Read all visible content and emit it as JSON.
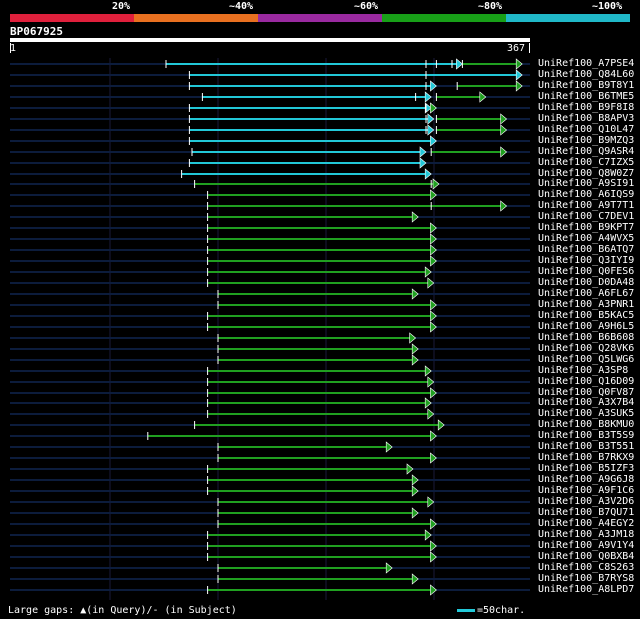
{
  "scale": {
    "labels": [
      "20%",
      "~40%",
      "~60%",
      "~80%",
      "~100%"
    ],
    "colors": [
      "#e0203c",
      "#e87020",
      "#9a2aa0",
      "#18a018",
      "#20b8c8"
    ]
  },
  "query": {
    "name": "BP067925",
    "start": "1",
    "end": "367"
  },
  "footer": {
    "gaps_text": "Large gaps: ▲(in Query)/- (in Subject)",
    "scale_text": "=50char."
  },
  "hits": [
    {
      "label": "UniRef100_A7PSE4",
      "segments": [
        {
          "color": "#22c8d8",
          "range": [
            0.3,
            0.87
          ]
        },
        {
          "color": "#20a020",
          "range": [
            0.87,
            0.985
          ]
        }
      ],
      "ticks": [
        0.8,
        0.82,
        0.85
      ]
    },
    {
      "label": "UniRef100_Q84L60",
      "segments": [
        {
          "color": "#22c8d8",
          "range": [
            0.345,
            0.985
          ]
        }
      ],
      "ticks": [
        0.8
      ]
    },
    {
      "label": "UniRef100_B9T8Y1",
      "segments": [
        {
          "color": "#22c8d8",
          "range": [
            0.345,
            0.82
          ]
        },
        {
          "color": "#20a020",
          "range": [
            0.86,
            0.985
          ]
        }
      ],
      "ticks": [
        0.8
      ]
    },
    {
      "label": "UniRef100_B6TME5",
      "segments": [
        {
          "color": "#22c8d8",
          "range": [
            0.37,
            0.81
          ]
        },
        {
          "color": "#20a020",
          "range": [
            0.82,
            0.915
          ]
        }
      ],
      "ticks": [
        0.78
      ]
    },
    {
      "label": "UniRef100_B9F8I8",
      "segments": [
        {
          "color": "#22c8d8",
          "range": [
            0.345,
            0.81
          ]
        },
        {
          "color": "#20a020",
          "range": [
            0.81,
            0.82
          ]
        }
      ],
      "ticks": [
        0.8
      ]
    },
    {
      "label": "UniRef100_B8APV3",
      "segments": [
        {
          "color": "#22c8d8",
          "range": [
            0.345,
            0.815
          ]
        },
        {
          "color": "#20a020",
          "range": [
            0.82,
            0.955
          ]
        }
      ],
      "ticks": [
        0.8
      ]
    },
    {
      "label": "UniRef100_Q10L47",
      "segments": [
        {
          "color": "#22c8d8",
          "range": [
            0.345,
            0.815
          ]
        },
        {
          "color": "#20a020",
          "range": [
            0.82,
            0.955
          ]
        }
      ],
      "ticks": [
        0.8
      ]
    },
    {
      "label": "UniRef100_B9MZQ3",
      "segments": [
        {
          "color": "#22c8d8",
          "range": [
            0.345,
            0.82
          ]
        }
      ],
      "ticks": []
    },
    {
      "label": "UniRef100_Q9ASR4",
      "segments": [
        {
          "color": "#22c8d8",
          "range": [
            0.35,
            0.8
          ]
        },
        {
          "color": "#20a020",
          "range": [
            0.81,
            0.955
          ]
        }
      ],
      "ticks": []
    },
    {
      "label": "UniRef100_C7IZX5",
      "segments": [
        {
          "color": "#22c8d8",
          "range": [
            0.345,
            0.8
          ]
        }
      ],
      "ticks": []
    },
    {
      "label": "UniRef100_Q8W0Z7",
      "segments": [
        {
          "color": "#22c8d8",
          "range": [
            0.33,
            0.81
          ]
        }
      ],
      "ticks": []
    },
    {
      "label": "UniRef100_A9SI91",
      "segments": [
        {
          "color": "#20a020",
          "range": [
            0.355,
            0.825
          ]
        }
      ],
      "ticks": [
        0.81
      ]
    },
    {
      "label": "UniRef100_A6IQS9",
      "segments": [
        {
          "color": "#20a020",
          "range": [
            0.38,
            0.82
          ]
        }
      ],
      "ticks": []
    },
    {
      "label": "UniRef100_A9T7T1",
      "segments": [
        {
          "color": "#20a020",
          "range": [
            0.38,
            0.955
          ]
        }
      ],
      "ticks": [
        0.81
      ]
    },
    {
      "label": "UniRef100_C7DEV1",
      "segments": [
        {
          "color": "#20a020",
          "range": [
            0.38,
            0.785
          ]
        }
      ],
      "ticks": []
    },
    {
      "label": "UniRef100_B9KPT7",
      "segments": [
        {
          "color": "#20a020",
          "range": [
            0.38,
            0.82
          ]
        }
      ],
      "ticks": []
    },
    {
      "label": "UniRef100_A4WVX5",
      "segments": [
        {
          "color": "#20a020",
          "range": [
            0.38,
            0.82
          ]
        }
      ],
      "ticks": []
    },
    {
      "label": "UniRef100_B6ATQ7",
      "segments": [
        {
          "color": "#20a020",
          "range": [
            0.38,
            0.82
          ]
        }
      ],
      "ticks": []
    },
    {
      "label": "UniRef100_Q3IYI9",
      "segments": [
        {
          "color": "#20a020",
          "range": [
            0.38,
            0.82
          ]
        }
      ],
      "ticks": []
    },
    {
      "label": "UniRef100_Q0FES6",
      "segments": [
        {
          "color": "#20a020",
          "range": [
            0.38,
            0.81
          ]
        }
      ],
      "ticks": []
    },
    {
      "label": "UniRef100_D0DA48",
      "segments": [
        {
          "color": "#20a020",
          "range": [
            0.38,
            0.815
          ]
        }
      ],
      "ticks": []
    },
    {
      "label": "UniRef100_A6FL67",
      "segments": [
        {
          "color": "#20a020",
          "range": [
            0.4,
            0.785
          ]
        }
      ],
      "ticks": []
    },
    {
      "label": "UniRef100_A3PNR1",
      "segments": [
        {
          "color": "#20a020",
          "range": [
            0.4,
            0.82
          ]
        }
      ],
      "ticks": []
    },
    {
      "label": "UniRef100_B5KAC5",
      "segments": [
        {
          "color": "#20a020",
          "range": [
            0.38,
            0.82
          ]
        }
      ],
      "ticks": []
    },
    {
      "label": "UniRef100_A9H6L5",
      "segments": [
        {
          "color": "#20a020",
          "range": [
            0.38,
            0.82
          ]
        }
      ],
      "ticks": []
    },
    {
      "label": "UniRef100_B6B608",
      "segments": [
        {
          "color": "#20a020",
          "range": [
            0.4,
            0.78
          ]
        }
      ],
      "ticks": []
    },
    {
      "label": "UniRef100_Q28VK6",
      "segments": [
        {
          "color": "#20a020",
          "range": [
            0.4,
            0.785
          ]
        }
      ],
      "ticks": []
    },
    {
      "label": "UniRef100_Q5LWG6",
      "segments": [
        {
          "color": "#20a020",
          "range": [
            0.4,
            0.785
          ]
        }
      ],
      "ticks": []
    },
    {
      "label": "UniRef100_A3SP8",
      "segments": [
        {
          "color": "#20a020",
          "range": [
            0.38,
            0.81
          ]
        }
      ],
      "ticks": []
    },
    {
      "label": "UniRef100_Q16D09",
      "segments": [
        {
          "color": "#20a020",
          "range": [
            0.38,
            0.815
          ]
        }
      ],
      "ticks": []
    },
    {
      "label": "UniRef100_Q0FV87",
      "segments": [
        {
          "color": "#20a020",
          "range": [
            0.38,
            0.82
          ]
        }
      ],
      "ticks": []
    },
    {
      "label": "UniRef100_A3X7B4",
      "segments": [
        {
          "color": "#20a020",
          "range": [
            0.38,
            0.81
          ]
        }
      ],
      "ticks": []
    },
    {
      "label": "UniRef100_A3SUK5",
      "segments": [
        {
          "color": "#20a020",
          "range": [
            0.38,
            0.815
          ]
        }
      ],
      "ticks": []
    },
    {
      "label": "UniRef100_B8KMU0",
      "segments": [
        {
          "color": "#20a020",
          "range": [
            0.355,
            0.835
          ]
        }
      ],
      "ticks": []
    },
    {
      "label": "UniRef100_B3T5S9",
      "segments": [
        {
          "color": "#20a020",
          "range": [
            0.265,
            0.82
          ]
        }
      ],
      "ticks": []
    },
    {
      "label": "UniRef100_B3T551",
      "segments": [
        {
          "color": "#20a020",
          "range": [
            0.4,
            0.735
          ]
        }
      ],
      "ticks": []
    },
    {
      "label": "UniRef100_B7RKX9",
      "segments": [
        {
          "color": "#20a020",
          "range": [
            0.4,
            0.82
          ]
        }
      ],
      "ticks": []
    },
    {
      "label": "UniRef100_B5IZF3",
      "segments": [
        {
          "color": "#20a020",
          "range": [
            0.38,
            0.775
          ]
        }
      ],
      "ticks": []
    },
    {
      "label": "UniRef100_A9G6J8",
      "segments": [
        {
          "color": "#20a020",
          "range": [
            0.38,
            0.785
          ]
        }
      ],
      "ticks": []
    },
    {
      "label": "UniRef100_A9F1C6",
      "segments": [
        {
          "color": "#20a020",
          "range": [
            0.38,
            0.785
          ]
        }
      ],
      "ticks": []
    },
    {
      "label": "UniRef100_A3V2D6",
      "segments": [
        {
          "color": "#20a020",
          "range": [
            0.4,
            0.815
          ]
        }
      ],
      "ticks": []
    },
    {
      "label": "UniRef100_B7QU71",
      "segments": [
        {
          "color": "#20a020",
          "range": [
            0.4,
            0.785
          ]
        }
      ],
      "ticks": []
    },
    {
      "label": "UniRef100_A4EGY2",
      "segments": [
        {
          "color": "#20a020",
          "range": [
            0.4,
            0.82
          ]
        }
      ],
      "ticks": []
    },
    {
      "label": "UniRef100_A3JM18",
      "segments": [
        {
          "color": "#20a020",
          "range": [
            0.38,
            0.81
          ]
        }
      ],
      "ticks": []
    },
    {
      "label": "UniRef100_A9V1Y4",
      "segments": [
        {
          "color": "#20a020",
          "range": [
            0.38,
            0.82
          ]
        }
      ],
      "ticks": []
    },
    {
      "label": "UniRef100_Q0BXB4",
      "segments": [
        {
          "color": "#20a020",
          "range": [
            0.38,
            0.82
          ]
        }
      ],
      "ticks": []
    },
    {
      "label": "UniRef100_C8S263",
      "segments": [
        {
          "color": "#20a020",
          "range": [
            0.4,
            0.735
          ]
        }
      ],
      "ticks": []
    },
    {
      "label": "UniRef100_B7RYS8",
      "segments": [
        {
          "color": "#20a020",
          "range": [
            0.4,
            0.785
          ]
        }
      ],
      "ticks": []
    },
    {
      "label": "UniRef100_A8LPD7",
      "segments": [
        {
          "color": "#20a020",
          "range": [
            0.38,
            0.82
          ]
        }
      ],
      "ticks": []
    }
  ]
}
